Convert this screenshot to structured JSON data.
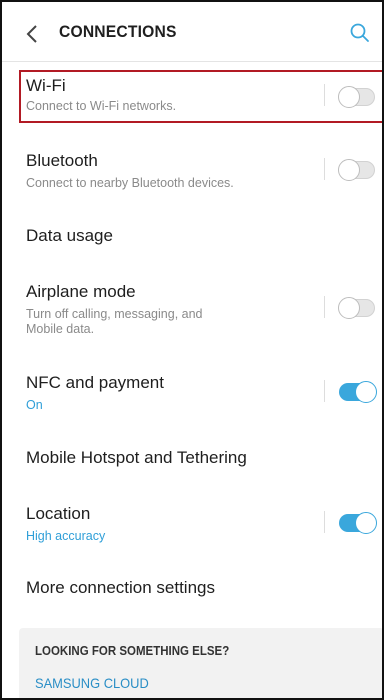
{
  "header": {
    "title": "CONNECTIONS",
    "back_icon": "chevron-left-icon",
    "search_icon": "search-icon"
  },
  "colors": {
    "accent": "#3aa7dc",
    "highlight_border": "#b21a24",
    "link": "#2a8ec6"
  },
  "settings": [
    {
      "title": "Wi-Fi",
      "subtitle": "Connect to Wi-Fi networks.",
      "toggle": "off"
    },
    {
      "title": "Bluetooth",
      "subtitle": "Connect to nearby Bluetooth devices.",
      "toggle": "off"
    },
    {
      "title": "Data usage"
    },
    {
      "title": "Airplane mode",
      "subtitle": "Turn off calling, messaging, and Mobile data.",
      "toggle": "off"
    },
    {
      "title": "NFC and payment",
      "subtitle": "On",
      "toggle": "on"
    },
    {
      "title": "Mobile Hotspot and Tethering"
    },
    {
      "title": "Location",
      "subtitle": "High accuracy",
      "toggle": "on"
    },
    {
      "title": "More connection settings"
    }
  ],
  "footer": {
    "heading": "LOOKING FOR SOMETHING ELSE?",
    "link": "SAMSUNG CLOUD"
  }
}
